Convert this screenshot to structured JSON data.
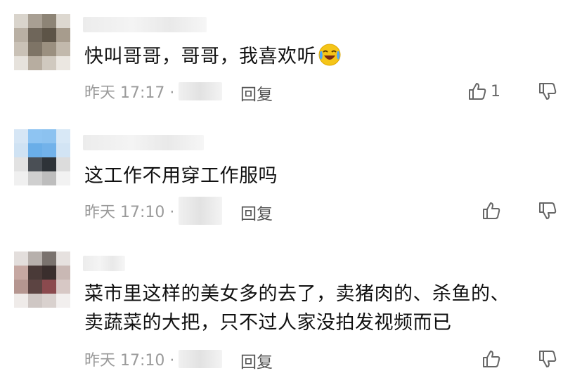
{
  "comments": [
    {
      "text": "快叫哥哥，哥哥，我喜欢听",
      "emoji": "laughing-crying-emoji",
      "time": "昨天 17:17 ·",
      "reply_label": "回复",
      "like_count": "1"
    },
    {
      "text": "这工作不用穿工作服吗",
      "time": "昨天 17:10 ·",
      "reply_label": "回复",
      "like_count": ""
    },
    {
      "text_line1": "菜市里这样的美女多的去了，卖猪肉的、杀鱼的、",
      "text_line2": "卖蔬菜的大把，只不过人家没拍发视频而已",
      "time": "昨天 17:10 ·",
      "reply_label": "回复",
      "like_count": ""
    }
  ],
  "icons": {
    "like": "thumbs-up-icon",
    "dislike": "thumbs-down-icon"
  }
}
